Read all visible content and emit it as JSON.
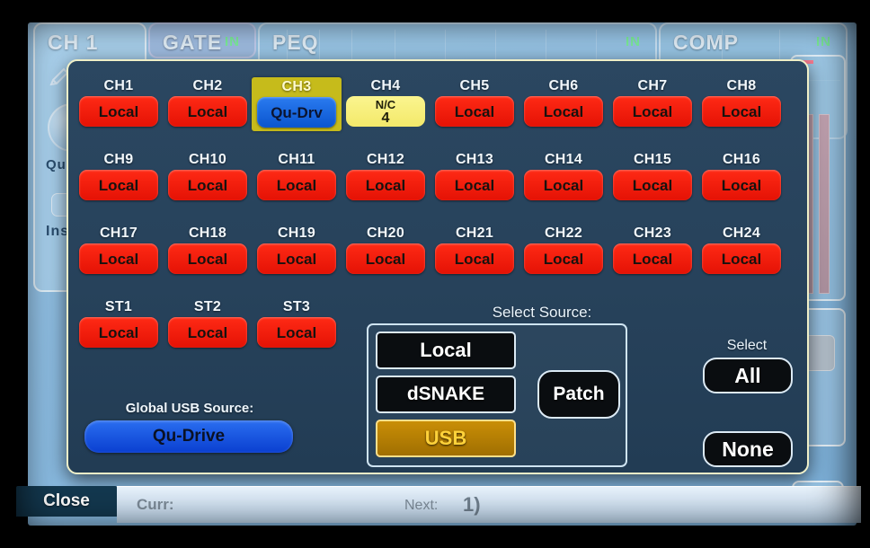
{
  "background": {
    "tabs": [
      {
        "label": "CH 1",
        "in": ""
      },
      {
        "label": "GATE",
        "in": "IN"
      },
      {
        "label": "PEQ",
        "in": "IN"
      },
      {
        "label": "COMP",
        "in": "IN"
      }
    ],
    "sidebar": {
      "pencil_icon": "pencil-icon",
      "knob_label": "Qu-",
      "insert_label": "Ins"
    }
  },
  "dialog": {
    "select_source_title": "Select Source:",
    "sources": [
      {
        "id": "local",
        "label": "Local",
        "active": false
      },
      {
        "id": "dsnake",
        "label": "dSNAKE",
        "active": false
      },
      {
        "id": "usb",
        "label": "USB",
        "active": true
      }
    ],
    "patch_label": "Patch",
    "global_usb": {
      "title": "Global USB Source:",
      "value": "Qu-Drive"
    },
    "select": {
      "title": "Select",
      "all_label": "All",
      "none_label": "None"
    },
    "channels": [
      {
        "name": "CH1",
        "source": "Local",
        "type": "local",
        "selected": false
      },
      {
        "name": "CH2",
        "source": "Local",
        "type": "local",
        "selected": false
      },
      {
        "name": "CH3",
        "source": "Qu-Drv",
        "type": "qudrv",
        "selected": true
      },
      {
        "name": "CH4",
        "source": "N/C",
        "sub": "4",
        "type": "nc",
        "selected": false
      },
      {
        "name": "CH5",
        "source": "Local",
        "type": "local",
        "selected": false
      },
      {
        "name": "CH6",
        "source": "Local",
        "type": "local",
        "selected": false
      },
      {
        "name": "CH7",
        "source": "Local",
        "type": "local",
        "selected": false
      },
      {
        "name": "CH8",
        "source": "Local",
        "type": "local",
        "selected": false
      },
      {
        "name": "CH9",
        "source": "Local",
        "type": "local",
        "selected": false
      },
      {
        "name": "CH10",
        "source": "Local",
        "type": "local",
        "selected": false
      },
      {
        "name": "CH11",
        "source": "Local",
        "type": "local",
        "selected": false
      },
      {
        "name": "CH12",
        "source": "Local",
        "type": "local",
        "selected": false
      },
      {
        "name": "CH13",
        "source": "Local",
        "type": "local",
        "selected": false
      },
      {
        "name": "CH14",
        "source": "Local",
        "type": "local",
        "selected": false
      },
      {
        "name": "CH15",
        "source": "Local",
        "type": "local",
        "selected": false
      },
      {
        "name": "CH16",
        "source": "Local",
        "type": "local",
        "selected": false
      },
      {
        "name": "CH17",
        "source": "Local",
        "type": "local",
        "selected": false
      },
      {
        "name": "CH18",
        "source": "Local",
        "type": "local",
        "selected": false
      },
      {
        "name": "CH19",
        "source": "Local",
        "type": "local",
        "selected": false
      },
      {
        "name": "CH20",
        "source": "Local",
        "type": "local",
        "selected": false
      },
      {
        "name": "CH21",
        "source": "Local",
        "type": "local",
        "selected": false
      },
      {
        "name": "CH22",
        "source": "Local",
        "type": "local",
        "selected": false
      },
      {
        "name": "CH23",
        "source": "Local",
        "type": "local",
        "selected": false
      },
      {
        "name": "CH24",
        "source": "Local",
        "type": "local",
        "selected": false
      },
      {
        "name": "ST1",
        "source": "Local",
        "type": "local",
        "selected": false
      },
      {
        "name": "ST2",
        "source": "Local",
        "type": "local",
        "selected": false
      },
      {
        "name": "ST3",
        "source": "Local",
        "type": "local",
        "selected": false
      }
    ]
  },
  "statusbar": {
    "close_label": "Close",
    "curr_label": "Curr:",
    "next_label": "Next:",
    "next_value": "1)"
  },
  "colors": {
    "local_red": "#e41205",
    "qudrive_blue": "#0a55cf",
    "nc_yellow": "#f3e96a",
    "usb_amber": "#ffd23a",
    "selected_olive": "#c6bb1b",
    "dialog_bg": "#27425b",
    "dialog_border": "#f0f0c8",
    "panel_blue": "#8fbfe4",
    "in_green": "#7df09a"
  }
}
